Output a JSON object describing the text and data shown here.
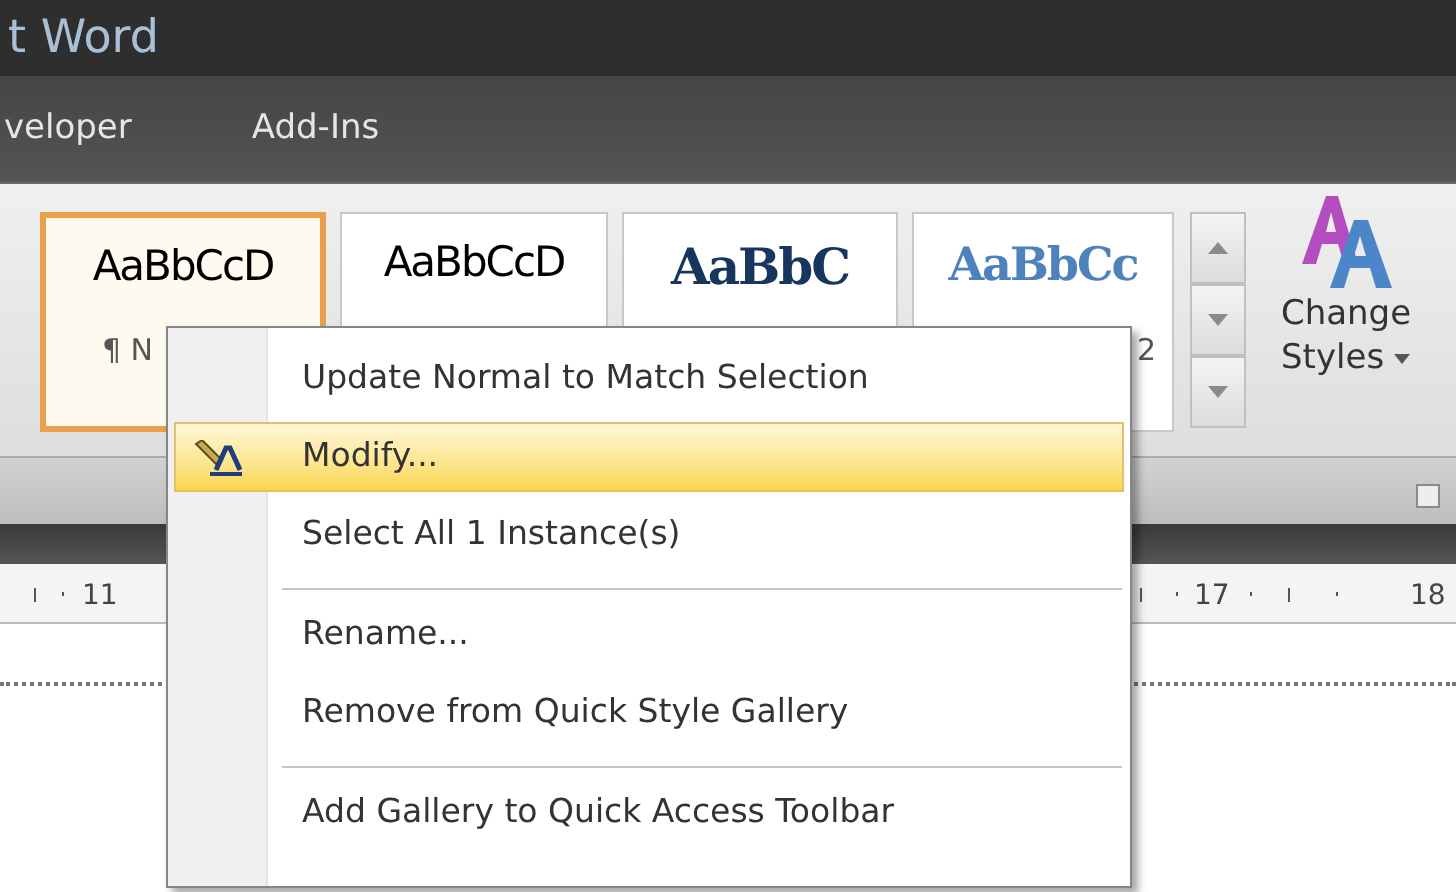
{
  "window": {
    "title": "t Word"
  },
  "tabs": [
    {
      "label": "veloper",
      "selected": false
    },
    {
      "label": "Add-Ins",
      "selected": false
    }
  ],
  "styles_gallery": {
    "tiles": [
      {
        "kind": "normal",
        "preview": "AaBbCcD",
        "label": "¶ N",
        "selected": true
      },
      {
        "kind": "plain",
        "preview": "AaBbCcD",
        "selected": false
      },
      {
        "kind": "heading1",
        "preview": "AaBbC",
        "selected": false
      },
      {
        "kind": "heading2",
        "preview": "AaBbCc",
        "label": "2",
        "selected": false
      }
    ]
  },
  "change_styles": {
    "label_line1": "Change",
    "label_line2": "Styles"
  },
  "ruler": {
    "left_number": "11",
    "right_numbers": [
      "17",
      "18"
    ]
  },
  "context_menu": {
    "items": [
      {
        "kind": "item",
        "label": "Update Normal to Match Selection",
        "selected": false
      },
      {
        "kind": "icon_item",
        "label": "Modify...",
        "selected": true
      },
      {
        "kind": "item",
        "label": "Select All 1 Instance(s)",
        "selected": false
      },
      {
        "kind": "separator"
      },
      {
        "kind": "item",
        "label": "Rename...",
        "selected": false
      },
      {
        "kind": "item",
        "label": "Remove from Quick Style Gallery",
        "selected": false
      },
      {
        "kind": "separator"
      },
      {
        "kind": "item",
        "label": "Add Gallery to Quick Access Toolbar",
        "selected": false
      }
    ]
  }
}
